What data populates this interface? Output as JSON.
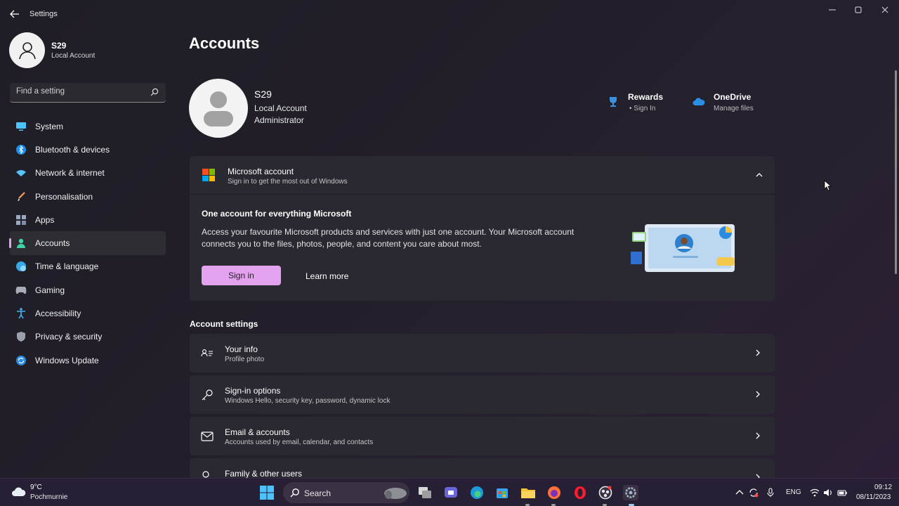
{
  "window": {
    "title": "Settings"
  },
  "profile": {
    "name": "S29",
    "type": "Local Account"
  },
  "search": {
    "placeholder": "Find a setting"
  },
  "sidebar": {
    "items": [
      {
        "label": "System",
        "icon": "monitor-icon"
      },
      {
        "label": "Bluetooth & devices",
        "icon": "bluetooth-icon"
      },
      {
        "label": "Network & internet",
        "icon": "wifi-icon"
      },
      {
        "label": "Personalisation",
        "icon": "brush-icon"
      },
      {
        "label": "Apps",
        "icon": "apps-icon"
      },
      {
        "label": "Accounts",
        "icon": "person-icon",
        "active": true
      },
      {
        "label": "Time & language",
        "icon": "globe-icon"
      },
      {
        "label": "Gaming",
        "icon": "gamepad-icon"
      },
      {
        "label": "Accessibility",
        "icon": "accessibility-icon"
      },
      {
        "label": "Privacy & security",
        "icon": "shield-icon"
      },
      {
        "label": "Windows Update",
        "icon": "update-icon"
      }
    ]
  },
  "page": {
    "title": "Accounts"
  },
  "account": {
    "name": "S29",
    "type": "Local Account",
    "role": "Administrator"
  },
  "quick_links": {
    "rewards": {
      "title": "Rewards",
      "sub": "• Sign In"
    },
    "onedrive": {
      "title": "OneDrive",
      "sub": "Manage files"
    }
  },
  "ms_account": {
    "title": "Microsoft account",
    "subtitle": "Sign in to get the most out of Windows",
    "promo_title": "One account for everything Microsoft",
    "promo_text": "Access your favourite Microsoft products and services with just one account. Your Microsoft account connects you to the files, photos, people, and content you care about most.",
    "signin_label": "Sign in",
    "learn_more_label": "Learn more"
  },
  "account_settings": {
    "title": "Account settings",
    "rows": [
      {
        "title": "Your info",
        "sub": "Profile photo"
      },
      {
        "title": "Sign-in options",
        "sub": "Windows Hello, security key, password, dynamic lock"
      },
      {
        "title": "Email & accounts",
        "sub": "Accounts used by email, calendar, and contacts"
      },
      {
        "title": "Family & other users",
        "sub": ""
      }
    ]
  },
  "taskbar": {
    "weather_temp": "9°C",
    "weather_desc": "Pochmurnie",
    "search_label": "Search",
    "language": "ENG",
    "time": "09:12",
    "date": "08/11/2023"
  },
  "colors": {
    "accent": "#e3a2ee",
    "card": "#2a2830",
    "taskbar": "#271f34"
  }
}
